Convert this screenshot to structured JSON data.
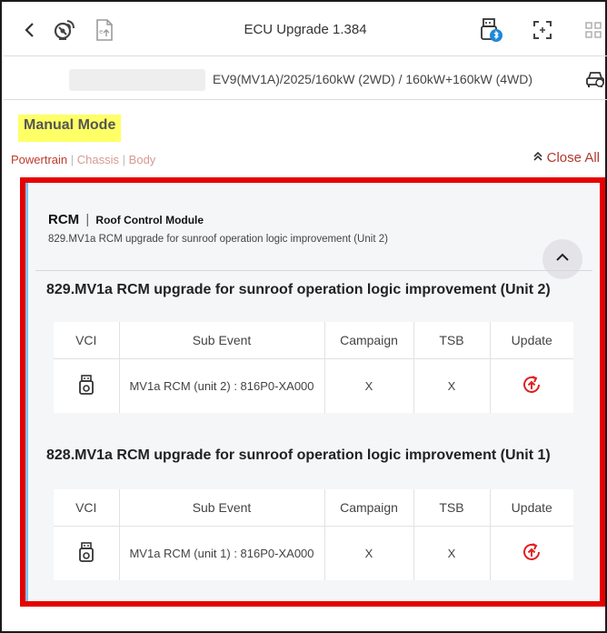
{
  "header": {
    "title": "ECU Upgrade 1.384"
  },
  "vehicle": {
    "spec": "EV9(MV1A)/2025/160kW (2WD) / 160kW+160kW (4WD)"
  },
  "mode_label": "Manual Mode",
  "filters": {
    "items": [
      "Powertrain",
      "Chassis",
      "Body"
    ],
    "separator": "|",
    "close_all": "Close All"
  },
  "module": {
    "code": "RCM",
    "separator": "|",
    "name": "Roof Control Module",
    "subtitle": "829.MV1a RCM upgrade for sunroof operation logic improvement (Unit 2)"
  },
  "table_headers": [
    "VCI",
    "Sub Event",
    "Campaign",
    "TSB",
    "Update"
  ],
  "events": [
    {
      "title": "829.MV1a RCM upgrade for sunroof operation logic improvement (Unit 2)",
      "row": {
        "sub_event": "MV1a RCM (unit 2) : 816P0-XA000",
        "campaign": "X",
        "tsb": "X"
      }
    },
    {
      "title": "828.MV1a RCM upgrade for sunroof operation logic improvement (Unit 1)",
      "row": {
        "sub_event": "MV1a RCM (unit 1) : 816P0-XA000",
        "campaign": "X",
        "tsb": "X"
      }
    }
  ],
  "colors": {
    "highlight_box": "#e60000",
    "mode_highlight": "#ffff66",
    "accent_red": "#c0392b",
    "update_icon": "#e02020",
    "panel_accent": "#7ec3e8"
  },
  "icons": [
    "back-icon",
    "satellite-dish-icon",
    "file-upload-icon",
    "usb-bluetooth-icon",
    "fullscreen-icon",
    "grid-icon",
    "car-settings-icon",
    "vci-device-icon",
    "update-icon",
    "chevron-up-icon",
    "double-chevron-up-icon"
  ]
}
